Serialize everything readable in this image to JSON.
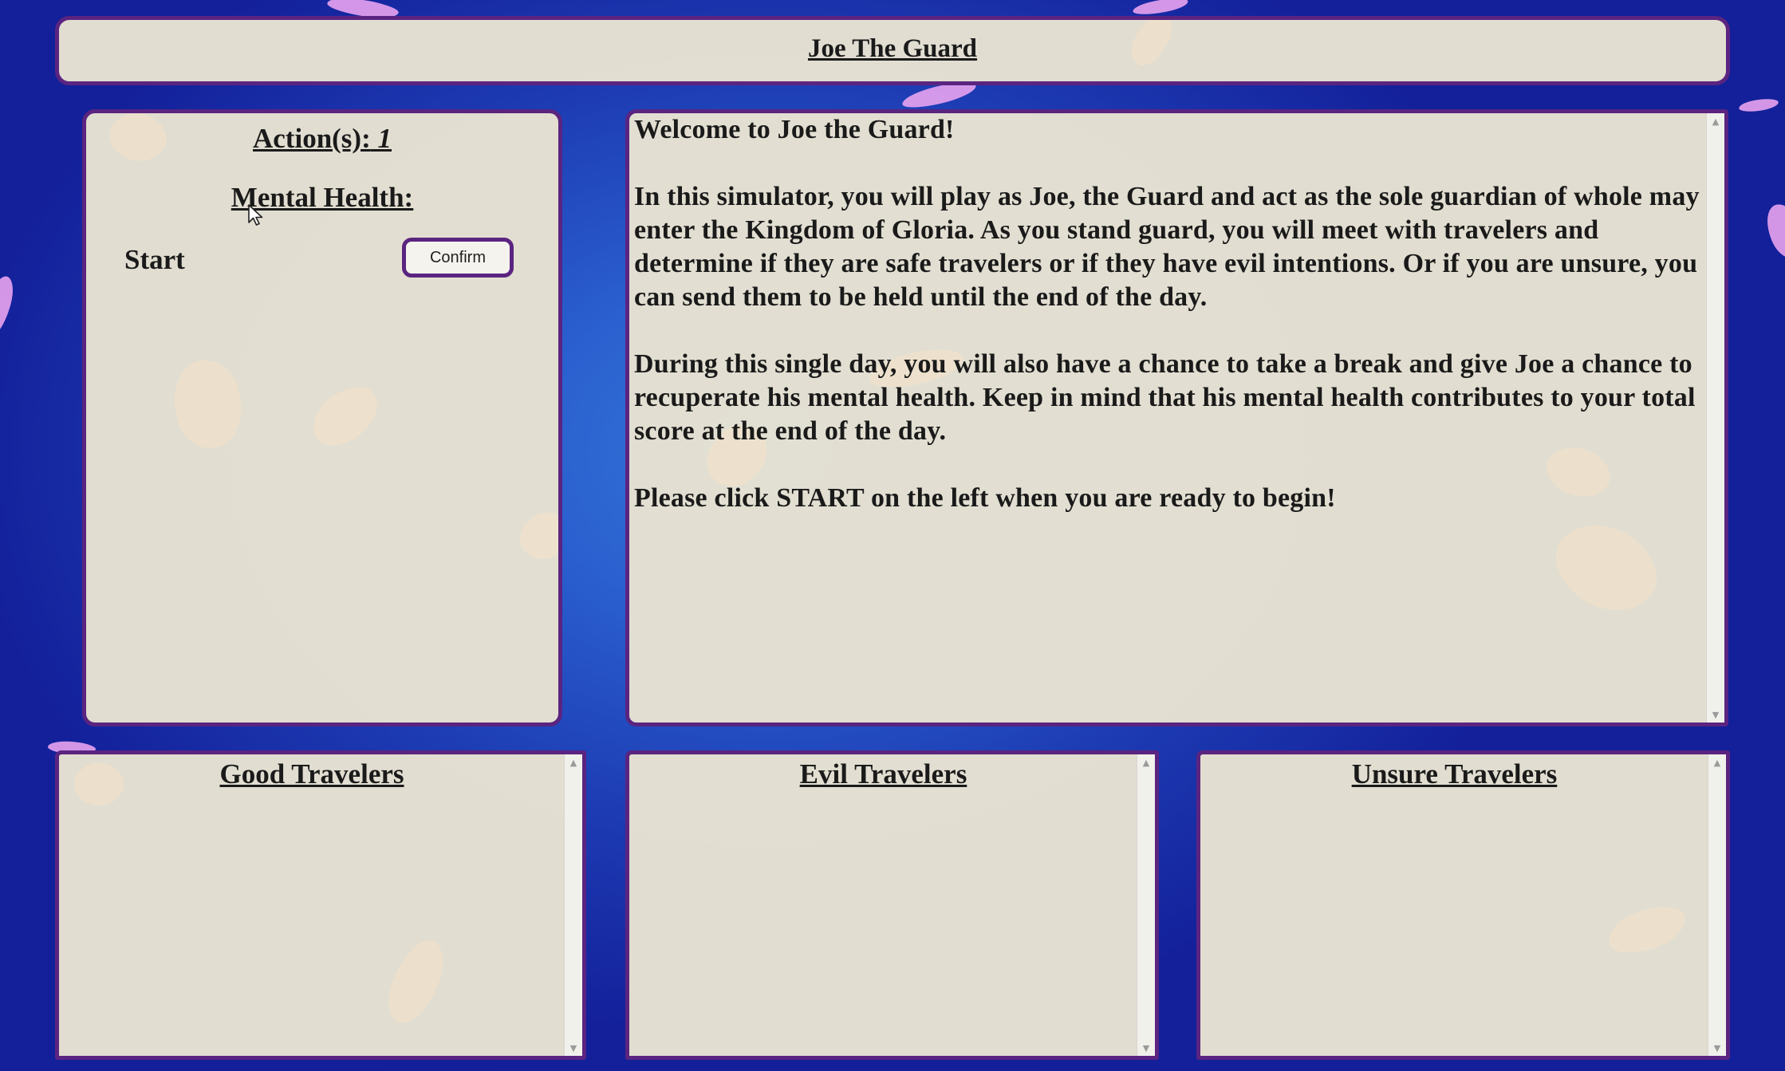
{
  "header": {
    "title": "Joe The Guard"
  },
  "status": {
    "actions_label": "Action(s):",
    "actions_count": "1",
    "mental_health_label": "Mental Health:"
  },
  "controls": {
    "option_label": "Start",
    "confirm_label": "Confirm"
  },
  "story": {
    "paragraphs": [
      "Welcome to Joe the Guard!",
      "In this simulator, you will play as Joe, the Guard and act as the sole guardian of whole may enter the Kingdom of Gloria. As you stand guard, you will meet with travelers and determine if they are safe travelers or if they have evil intentions. Or if you are unsure, you can send them to be held until the end of the day.",
      "During this single day, you will also have a chance to take a break and give Joe a chance to recuperate his mental health. Keep in mind that his mental health contributes to your total score at the end of the day.",
      "Please click START on the left when you are ready to begin!"
    ]
  },
  "travelers": {
    "good_title": "Good Travelers",
    "evil_title": "Evil Travelers",
    "unsure_title": "Unsure Travelers"
  },
  "scroll_icons": {
    "up": "▲",
    "down": "▼"
  },
  "colors": {
    "panel_border": "#5a2480",
    "panel_background": "#e8e3d2",
    "background": "#1d3bb3",
    "petal_pink": "#e9a3f0"
  }
}
